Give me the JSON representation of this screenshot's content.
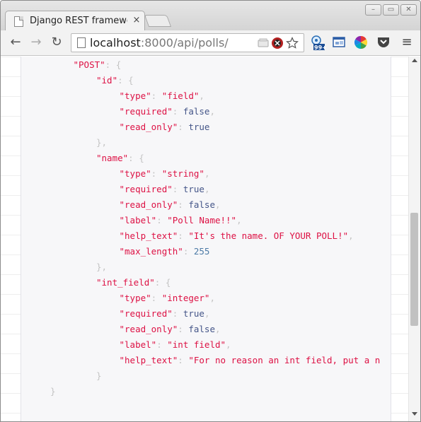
{
  "window": {
    "minimize": "–",
    "restore": "▭",
    "close": "✕"
  },
  "tab": {
    "title": "Django REST framework",
    "close": "×"
  },
  "toolbar": {
    "back": "←",
    "forward": "→",
    "reload": "↻",
    "url_host": "localhost",
    "url_rest": ":8000/api/polls/",
    "menu": "≡"
  },
  "extensions": {
    "badge_count": "99+"
  },
  "json_lines": [
    {
      "indent": 3,
      "parts": [
        [
          "key",
          "\"POST\""
        ],
        [
          "punc",
          ": {"
        ]
      ]
    },
    {
      "indent": 4,
      "parts": [
        [
          "key",
          "\"id\""
        ],
        [
          "punc",
          ": {"
        ]
      ]
    },
    {
      "indent": 5,
      "parts": [
        [
          "key",
          "\"type\""
        ],
        [
          "punc",
          ": "
        ],
        [
          "str",
          "\"field\""
        ],
        [
          "punc",
          ","
        ]
      ]
    },
    {
      "indent": 5,
      "parts": [
        [
          "key",
          "\"required\""
        ],
        [
          "punc",
          ": "
        ],
        [
          "kw",
          "false"
        ],
        [
          "punc",
          ","
        ]
      ]
    },
    {
      "indent": 5,
      "parts": [
        [
          "key",
          "\"read_only\""
        ],
        [
          "punc",
          ": "
        ],
        [
          "kw",
          "true"
        ]
      ]
    },
    {
      "indent": 4,
      "parts": [
        [
          "punc",
          "},"
        ]
      ]
    },
    {
      "indent": 4,
      "parts": [
        [
          "key",
          "\"name\""
        ],
        [
          "punc",
          ": {"
        ]
      ]
    },
    {
      "indent": 5,
      "parts": [
        [
          "key",
          "\"type\""
        ],
        [
          "punc",
          ": "
        ],
        [
          "str",
          "\"string\""
        ],
        [
          "punc",
          ","
        ]
      ]
    },
    {
      "indent": 5,
      "parts": [
        [
          "key",
          "\"required\""
        ],
        [
          "punc",
          ": "
        ],
        [
          "kw",
          "true"
        ],
        [
          "punc",
          ","
        ]
      ]
    },
    {
      "indent": 5,
      "parts": [
        [
          "key",
          "\"read_only\""
        ],
        [
          "punc",
          ": "
        ],
        [
          "kw",
          "false"
        ],
        [
          "punc",
          ","
        ]
      ]
    },
    {
      "indent": 5,
      "parts": [
        [
          "key",
          "\"label\""
        ],
        [
          "punc",
          ": "
        ],
        [
          "str",
          "\"Poll Name!!\""
        ],
        [
          "punc",
          ","
        ]
      ]
    },
    {
      "indent": 5,
      "parts": [
        [
          "key",
          "\"help_text\""
        ],
        [
          "punc",
          ": "
        ],
        [
          "str",
          "\"It's the name. OF YOUR POLL!\""
        ],
        [
          "punc",
          ","
        ]
      ]
    },
    {
      "indent": 5,
      "parts": [
        [
          "key",
          "\"max_length\""
        ],
        [
          "punc",
          ": "
        ],
        [
          "num",
          "255"
        ]
      ]
    },
    {
      "indent": 4,
      "parts": [
        [
          "punc",
          "},"
        ]
      ]
    },
    {
      "indent": 4,
      "parts": [
        [
          "key",
          "\"int_field\""
        ],
        [
          "punc",
          ": {"
        ]
      ]
    },
    {
      "indent": 5,
      "parts": [
        [
          "key",
          "\"type\""
        ],
        [
          "punc",
          ": "
        ],
        [
          "str",
          "\"integer\""
        ],
        [
          "punc",
          ","
        ]
      ]
    },
    {
      "indent": 5,
      "parts": [
        [
          "key",
          "\"required\""
        ],
        [
          "punc",
          ": "
        ],
        [
          "kw",
          "true"
        ],
        [
          "punc",
          ","
        ]
      ]
    },
    {
      "indent": 5,
      "parts": [
        [
          "key",
          "\"read_only\""
        ],
        [
          "punc",
          ": "
        ],
        [
          "kw",
          "false"
        ],
        [
          "punc",
          ","
        ]
      ]
    },
    {
      "indent": 5,
      "parts": [
        [
          "key",
          "\"label\""
        ],
        [
          "punc",
          ": "
        ],
        [
          "str",
          "\"int field\""
        ],
        [
          "punc",
          ","
        ]
      ]
    },
    {
      "indent": 5,
      "parts": [
        [
          "key",
          "\"help_text\""
        ],
        [
          "punc",
          ": "
        ],
        [
          "str",
          "\"For no reason an int field, put a n"
        ]
      ]
    },
    {
      "indent": 4,
      "parts": [
        [
          "punc",
          "}"
        ]
      ]
    },
    {
      "indent": 2,
      "parts": [
        [
          "punc",
          "}"
        ]
      ]
    }
  ],
  "colors": {
    "key": "#dd1144",
    "string": "#dd1144",
    "keyword": "#445588",
    "number": "#4c7aa6",
    "punctuation": "#c4c4c4"
  }
}
